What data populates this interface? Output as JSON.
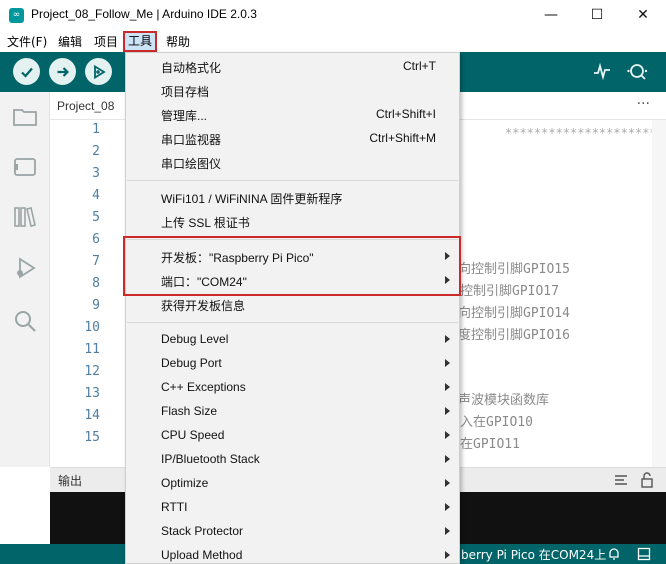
{
  "window": {
    "title": "Project_08_Follow_Me | Arduino IDE 2.0.3",
    "app_icon": "∞",
    "minimize": "—",
    "maximize": "☐",
    "close": "✕"
  },
  "menubar": {
    "items": [
      "文件(F)",
      "编辑",
      "项目",
      "工具",
      "帮助"
    ]
  },
  "editor": {
    "tab": "Project_08",
    "tab_menu": "···",
    "line_numbers": [
      "1",
      "2",
      "3",
      "4",
      "5",
      "6",
      "7",
      "8",
      "9",
      "10",
      "11",
      "12",
      "13",
      "14",
      "15"
    ],
    "code_fragments": [
      "向控制引脚GPIO15",
      "控制引脚GPIO17",
      "向控制引脚GPIO14",
      "度控制引脚GPIO16",
      "声波模块函数库",
      "入在GPIO10",
      "在GPIO11"
    ],
    "comment_stars": "*********************************"
  },
  "output": {
    "label": "输出"
  },
  "statusbar": {
    "text": "berry Pi Pico 在COM24上"
  },
  "tools_menu": {
    "group1": [
      {
        "label": "自动格式化",
        "shortcut": "Ctrl+T"
      },
      {
        "label": "项目存档",
        "shortcut": ""
      },
      {
        "label": "管理库...",
        "shortcut": "Ctrl+Shift+I"
      },
      {
        "label": "串口监视器",
        "shortcut": "Ctrl+Shift+M"
      },
      {
        "label": "串口绘图仪",
        "shortcut": ""
      }
    ],
    "group2": [
      {
        "label": "WiFi101 / WiFiNINA 固件更新程序"
      },
      {
        "label": "上传 SSL 根证书"
      }
    ],
    "group3": [
      {
        "label": "开发板：\"Raspberry Pi Pico\""
      },
      {
        "label": "端口：\"COM24\""
      },
      {
        "label": "获得开发板信息"
      }
    ],
    "group4": [
      {
        "label": "Debug Level"
      },
      {
        "label": "Debug Port"
      },
      {
        "label": "C++ Exceptions"
      },
      {
        "label": "Flash Size"
      },
      {
        "label": "CPU Speed"
      },
      {
        "label": "IP/Bluetooth Stack"
      },
      {
        "label": "Optimize"
      },
      {
        "label": "RTTI"
      },
      {
        "label": "Stack Protector"
      },
      {
        "label": "Upload Method"
      }
    ]
  },
  "colors": {
    "toolbar": "#006468",
    "highlight": "#cc2a2a"
  }
}
